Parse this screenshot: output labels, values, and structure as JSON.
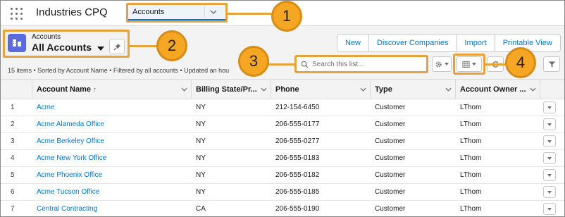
{
  "app": {
    "name": "Industries CPQ"
  },
  "nav": {
    "tab_label": "Accounts"
  },
  "callouts": [
    "1",
    "2",
    "3",
    "4"
  ],
  "header": {
    "object_label": "Accounts",
    "view_name": "All Accounts",
    "list_info": "15 items • Sorted by Account Name • Filtered by all accounts • Updated an hou"
  },
  "actions": {
    "new": "New",
    "discover": "Discover Companies",
    "import": "Import",
    "printable": "Printable View"
  },
  "search": {
    "placeholder": "Search this list..."
  },
  "icons": {
    "settings": "gear-icon",
    "table_view": "table-icon",
    "refresh": "refresh-icon",
    "filter": "filter-icon",
    "pin": "pin-icon",
    "object": "account-icon",
    "search": "search-icon"
  },
  "colors": {
    "accent": "#0176d3",
    "callout": "#f5a623",
    "object_icon": "#5a6bdb"
  },
  "table": {
    "columns": [
      "Account Name",
      "Billing State/Pr...",
      "Phone",
      "Type",
      "Account Owner ..."
    ],
    "sort_indicator": "↑",
    "rows": [
      {
        "n": "1",
        "name": "Acme",
        "state": "NY",
        "phone": "212-154-6450",
        "type": "Customer",
        "owner": "LThom"
      },
      {
        "n": "2",
        "name": "Acme Alameda Office",
        "state": "NY",
        "phone": "206-555-0177",
        "type": "Customer",
        "owner": "LThom"
      },
      {
        "n": "3",
        "name": "Acme Berkeley Office",
        "state": "NY",
        "phone": "206-555-0277",
        "type": "Customer",
        "owner": "LThom"
      },
      {
        "n": "4",
        "name": "Acme New York Office",
        "state": "NY",
        "phone": "206-555-0183",
        "type": "Customer",
        "owner": "LThom"
      },
      {
        "n": "5",
        "name": "Acme Phoenix Office",
        "state": "NY",
        "phone": "206-555-0182",
        "type": "Customer",
        "owner": "LThom"
      },
      {
        "n": "6",
        "name": "Acme Tucson Office",
        "state": "NY",
        "phone": "206-555-0185",
        "type": "Customer",
        "owner": "LThom"
      },
      {
        "n": "7",
        "name": "Central Contracting",
        "state": "CA",
        "phone": "206-555-0190",
        "type": "Customer",
        "owner": "LThom"
      }
    ]
  }
}
